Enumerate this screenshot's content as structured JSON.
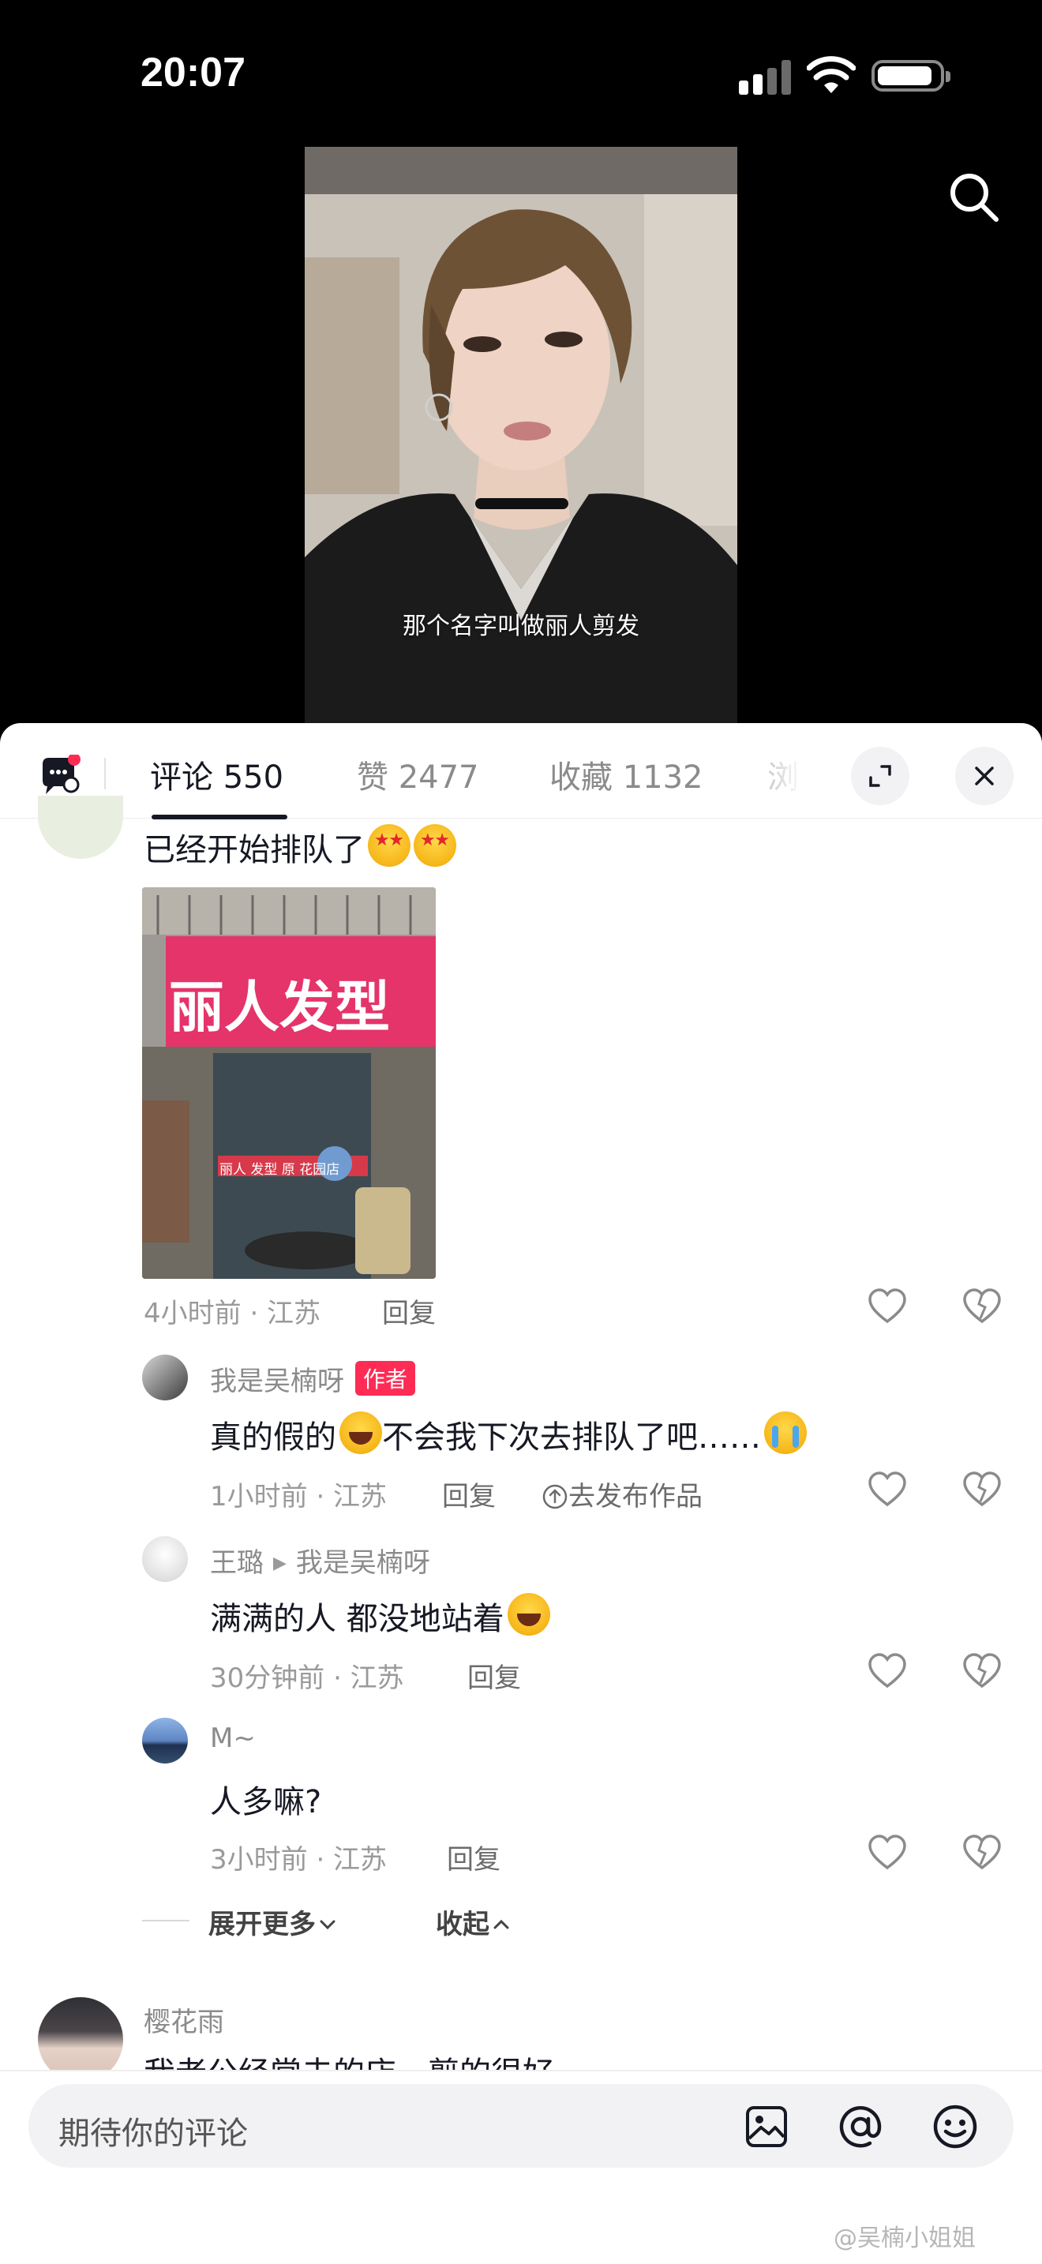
{
  "status_bar": {
    "time": "20:07"
  },
  "video": {
    "subtitle": "那个名字叫做丽人剪发"
  },
  "tabs": [
    {
      "label": "评论 550",
      "active": true
    },
    {
      "label": "赞 2477"
    },
    {
      "label": "收藏 1132"
    },
    {
      "label": "浏"
    }
  ],
  "comments": {
    "top": {
      "text": "已经开始排队了",
      "emojis": [
        "star-eyes",
        "star-eyes"
      ],
      "photo_sign": "丽人发型",
      "photo_door": "丽人 发型 原 花园店",
      "time_location": "4小时前 · 江苏",
      "reply_label": "回复"
    },
    "replies": [
      {
        "name": "我是吴楠呀",
        "badge": "作者",
        "text": "真的假的",
        "text_after": "不会我下次去排队了吧……",
        "time_location": "1小时前 · 江苏",
        "reply_label": "回复",
        "publish_label": "去发布作品"
      },
      {
        "name": "王璐",
        "reply_to": "我是吴楠呀",
        "text": "满满的人 都没地站着",
        "time_location": "30分钟前 · 江苏",
        "reply_label": "回复"
      },
      {
        "name": "M~",
        "text": "人多嘛?",
        "time_location": "3小时前 · 江苏",
        "reply_label": "回复"
      }
    ],
    "expand_more": "展开更多",
    "collapse": "收起",
    "next": {
      "name": "樱花雨",
      "text_partial": "我老公经常去的店，剪的很好"
    }
  },
  "input": {
    "placeholder": "期待你的评论"
  },
  "watermark": "@吴楠小姐姐",
  "colors": {
    "accent": "#fe2c55",
    "text": "#161823",
    "muted": "#8b8b8b"
  }
}
